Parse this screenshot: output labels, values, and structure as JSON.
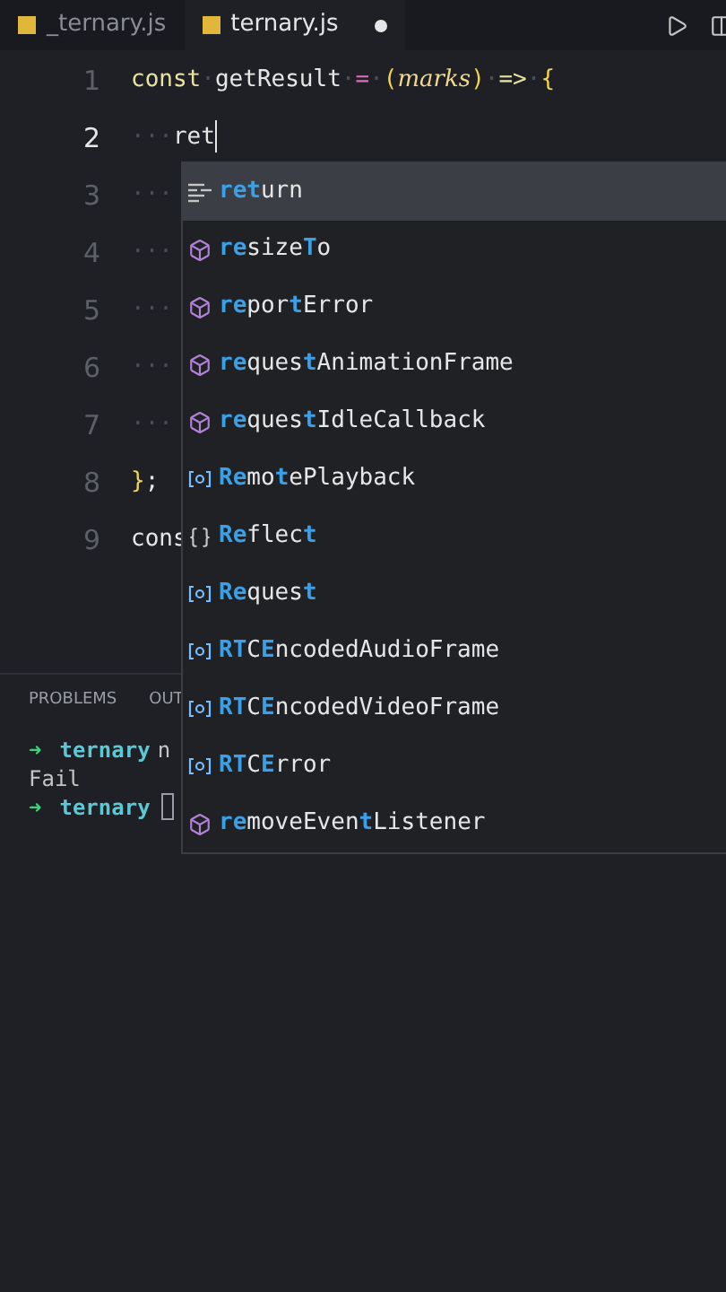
{
  "tabs": [
    {
      "label": "_ternary.js",
      "selected": false,
      "modified": false
    },
    {
      "label": "ternary.js",
      "selected": true,
      "modified": true
    }
  ],
  "editor": {
    "lines": [
      {
        "number": "1",
        "tokens": [
          {
            "text": "const",
            "kind": "keyword"
          },
          {
            "text": "·",
            "kind": "ws"
          },
          {
            "text": "getResult",
            "kind": "name"
          },
          {
            "text": "·",
            "kind": "ws"
          },
          {
            "text": "=",
            "kind": "operator"
          },
          {
            "text": "·",
            "kind": "ws"
          },
          {
            "text": "(",
            "kind": "bracket"
          },
          {
            "text": "marks",
            "kind": "param"
          },
          {
            "text": ")",
            "kind": "bracket"
          },
          {
            "text": "·",
            "kind": "ws"
          },
          {
            "text": "=>",
            "kind": "keyword"
          },
          {
            "text": "·",
            "kind": "ws"
          },
          {
            "text": "{",
            "kind": "bracket"
          }
        ]
      },
      {
        "number": "2",
        "current": true,
        "tokens": [
          {
            "text": "···",
            "kind": "ws"
          },
          {
            "text": "ret",
            "kind": "name"
          }
        ]
      },
      {
        "number": "3",
        "tokens": [
          {
            "text": "···",
            "kind": "ws"
          }
        ]
      },
      {
        "number": "4",
        "tokens": [
          {
            "text": "···",
            "kind": "ws"
          }
        ]
      },
      {
        "number": "5",
        "tokens": [
          {
            "text": "···",
            "kind": "ws"
          }
        ]
      },
      {
        "number": "6",
        "tokens": [
          {
            "text": "···",
            "kind": "ws"
          }
        ]
      },
      {
        "number": "7",
        "tokens": [
          {
            "text": "···",
            "kind": "ws"
          }
        ]
      },
      {
        "number": "8",
        "tokens": [
          {
            "text": "}",
            "kind": "bracket"
          },
          {
            "text": ";",
            "kind": "name"
          }
        ]
      },
      {
        "number": "9",
        "tokens": [
          {
            "text": "cons",
            "kind": "name"
          }
        ]
      }
    ]
  },
  "suggestions": [
    {
      "kind": "keyword",
      "selected": true,
      "parts": [
        {
          "text": "ret",
          "match": true
        },
        {
          "text": "urn",
          "match": false
        }
      ]
    },
    {
      "kind": "method",
      "selected": false,
      "parts": [
        {
          "text": "re",
          "match": true
        },
        {
          "text": "size",
          "match": false
        },
        {
          "text": "T",
          "match": true
        },
        {
          "text": "o",
          "match": false
        }
      ]
    },
    {
      "kind": "method",
      "selected": false,
      "parts": [
        {
          "text": "re",
          "match": true
        },
        {
          "text": "por",
          "match": false
        },
        {
          "text": "t",
          "match": true
        },
        {
          "text": "Error",
          "match": false
        }
      ]
    },
    {
      "kind": "method",
      "selected": false,
      "parts": [
        {
          "text": "re",
          "match": true
        },
        {
          "text": "ques",
          "match": false
        },
        {
          "text": "t",
          "match": true
        },
        {
          "text": "AnimationFrame",
          "match": false
        }
      ]
    },
    {
      "kind": "method",
      "selected": false,
      "parts": [
        {
          "text": "re",
          "match": true
        },
        {
          "text": "ques",
          "match": false
        },
        {
          "text": "t",
          "match": true
        },
        {
          "text": "IdleCallback",
          "match": false
        }
      ]
    },
    {
      "kind": "variable",
      "selected": false,
      "parts": [
        {
          "text": "Re",
          "match": true
        },
        {
          "text": "mo",
          "match": false
        },
        {
          "text": "t",
          "match": true
        },
        {
          "text": "ePlayback",
          "match": false
        }
      ]
    },
    {
      "kind": "module",
      "selected": false,
      "parts": [
        {
          "text": "Re",
          "match": true
        },
        {
          "text": "flec",
          "match": false
        },
        {
          "text": "t",
          "match": true
        }
      ]
    },
    {
      "kind": "variable",
      "selected": false,
      "parts": [
        {
          "text": "Re",
          "match": true
        },
        {
          "text": "ques",
          "match": false
        },
        {
          "text": "t",
          "match": true
        }
      ]
    },
    {
      "kind": "variable",
      "selected": false,
      "parts": [
        {
          "text": "RT",
          "match": true
        },
        {
          "text": "C",
          "match": false
        },
        {
          "text": "E",
          "match": true
        },
        {
          "text": "ncodedAudioFrame",
          "match": false
        }
      ]
    },
    {
      "kind": "variable",
      "selected": false,
      "parts": [
        {
          "text": "RT",
          "match": true
        },
        {
          "text": "C",
          "match": false
        },
        {
          "text": "E",
          "match": true
        },
        {
          "text": "ncodedVideoFrame",
          "match": false
        }
      ]
    },
    {
      "kind": "variable",
      "selected": false,
      "parts": [
        {
          "text": "RT",
          "match": true
        },
        {
          "text": "C",
          "match": false
        },
        {
          "text": "E",
          "match": true
        },
        {
          "text": "rror",
          "match": false
        }
      ]
    },
    {
      "kind": "method",
      "selected": false,
      "parts": [
        {
          "text": "re",
          "match": true
        },
        {
          "text": "moveEven",
          "match": false
        },
        {
          "text": "t",
          "match": true
        },
        {
          "text": "Listener",
          "match": false
        }
      ]
    }
  ],
  "panel": {
    "tabs": [
      "PROBLEMS",
      "OUT"
    ],
    "terminal": [
      {
        "kind": "prompt",
        "arrow": "➜",
        "dir": "ternary",
        "rest": "n"
      },
      {
        "kind": "output",
        "text": "Fail"
      },
      {
        "kind": "prompt",
        "arrow": "➜",
        "dir": "ternary",
        "cursor": true
      }
    ]
  }
}
